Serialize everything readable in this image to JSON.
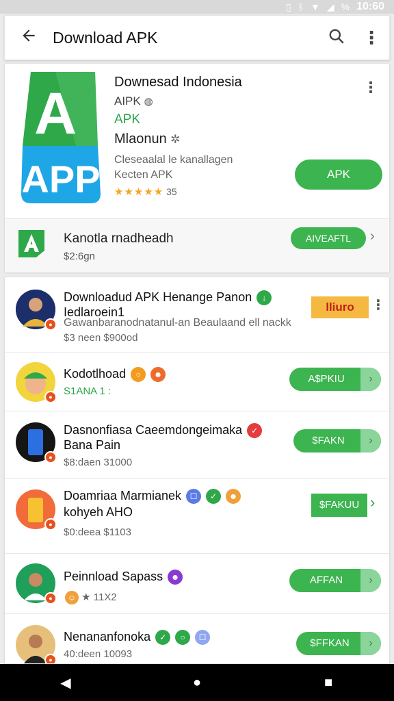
{
  "status_bar": {
    "time": "10:60",
    "icons": [
      "vibrate-icon",
      "bluetooth-icon",
      "wifi-icon",
      "signal-icon",
      "battery-icon"
    ],
    "battery_text": "%"
  },
  "app_bar": {
    "title": "Download APK",
    "back_icon": "arrow-left-icon",
    "search_icon": "search-icon",
    "menu_icon": "more-vert-icon"
  },
  "featured": {
    "logo_text_top": "A",
    "logo_text_bottom": "APP",
    "name": "Downesad Indonesia",
    "line2": "AIPK",
    "line3": "APK",
    "developer": "Mlaonun",
    "desc_line1": "Cleseaalal le kanallagen",
    "desc_line2": "Kecten APK",
    "rating_stars": "★★★★★",
    "rating_count": "35",
    "install_label": "APK",
    "sub": {
      "title": "Kanotla rnadheadh",
      "price": "$2:6gn",
      "button": "AIVEAFTL",
      "chevron": "›"
    }
  },
  "list": [
    {
      "title1": "Downloadud APK Henange Panon",
      "title2": "Iedlaroein1",
      "sub1": "Gawanbaranodnatanul-an Beaulaand ell nackk",
      "sub2": "$3 neen $900od",
      "badge": "lliuro"
    },
    {
      "title1": "Kodotlhoad",
      "sub1": "S1ANA 1 :",
      "button": "A$PKIU"
    },
    {
      "title1": "Dasnonfiasa Caeemdongeimaka",
      "title2": "Bana Pain",
      "sub1": "$8:daen 31000",
      "button": "$FAKN"
    },
    {
      "title1": "Doamriaa Marmianek",
      "title2": "kohyeh AHO",
      "sub1": "$0:deea $1103",
      "button": "$FAKUU"
    },
    {
      "title1": "Peinnload Sapass",
      "sub1": "★ 11X2",
      "button": "AFFAN"
    },
    {
      "title1": "Nenananfonoka",
      "sub1": "40:deen 10093",
      "button": "$FFKAN"
    }
  ],
  "nav_bar": {
    "back": "◀",
    "home": "●",
    "recents": "■"
  },
  "colors": {
    "accent_green": "#3cb44f",
    "star": "#f6a623",
    "badge_orange": "#f5b942"
  }
}
